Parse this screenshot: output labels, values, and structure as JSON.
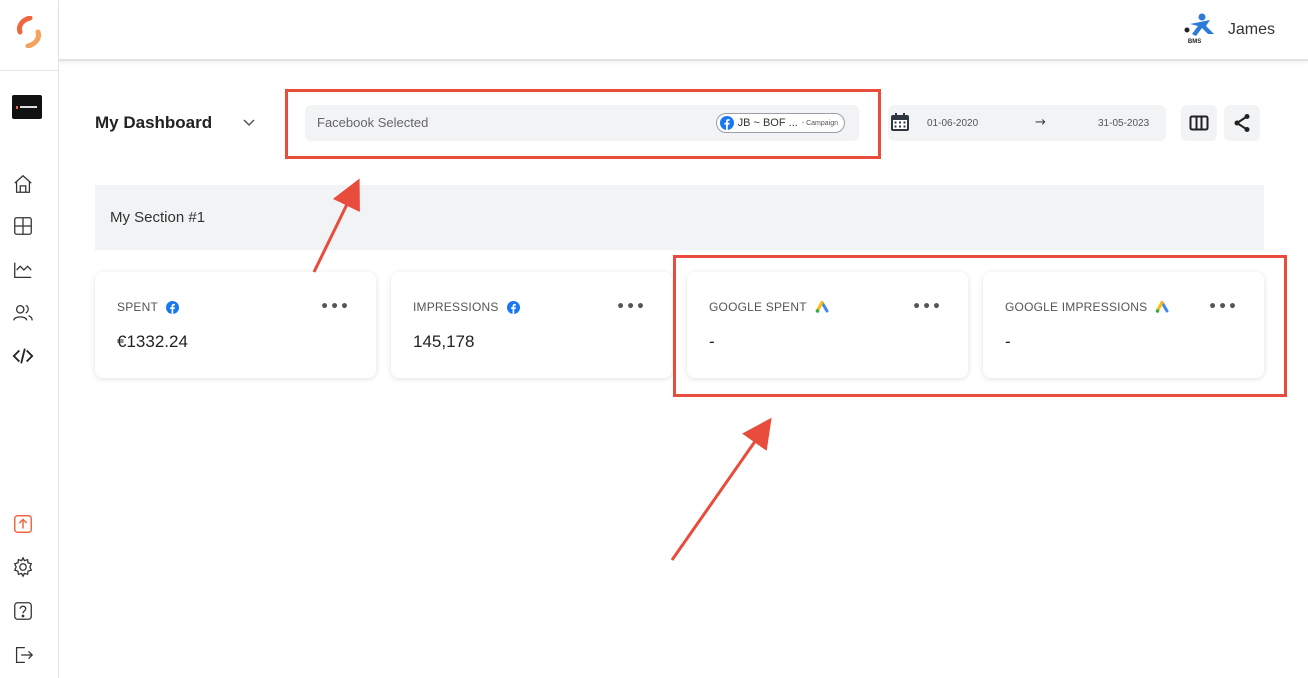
{
  "user": {
    "name": "James",
    "logo_text": "BMS"
  },
  "dashboard": {
    "title": "My Dashboard"
  },
  "filter": {
    "label": "Facebook Selected",
    "chip_text": "JB ~ BOF ...",
    "chip_sub": "- Campaign"
  },
  "date_range": {
    "start": "01-06-2020",
    "arrow": "→",
    "end": "31-05-2023"
  },
  "section": {
    "title": "My Section #1"
  },
  "cards": [
    {
      "label": "SPENT",
      "value": "€1332.24",
      "source": "facebook-icon"
    },
    {
      "label": "IMPRESSIONS",
      "value": "145,178",
      "source": "facebook-icon"
    },
    {
      "label": "GOOGLE SPENT",
      "value": "-",
      "source": "google-ads-icon"
    },
    {
      "label": "GOOGLE IMPRESSIONS",
      "value": "-",
      "source": "google-ads-icon"
    }
  ],
  "card_menu": "•••",
  "colors": {
    "annotation": "#e74c3c",
    "facebook": "#1877f2",
    "accent": "#f0663f"
  }
}
